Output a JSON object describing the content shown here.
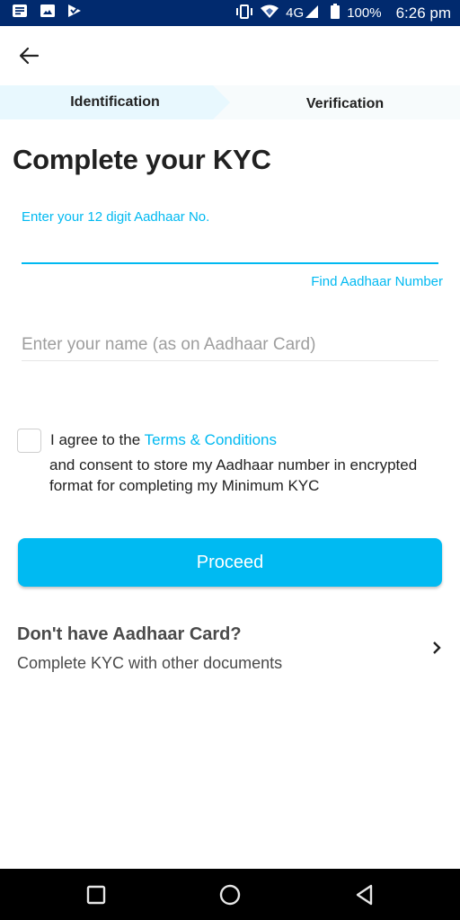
{
  "status_bar": {
    "left_icons": [
      "notes-icon",
      "image-icon",
      "checkmark-app-icon"
    ],
    "right_icons": [
      "vibrate-icon",
      "wifi-icon",
      "signal-icon",
      "battery-icon"
    ],
    "network": "4G",
    "battery": "100%",
    "time": "6:26 pm"
  },
  "toolbar": {
    "back_icon": "arrow-left-icon"
  },
  "stepper": {
    "steps": [
      {
        "label": "Identification",
        "active": true
      },
      {
        "label": "Verification",
        "active": false
      }
    ]
  },
  "page": {
    "title": "Complete your KYC"
  },
  "aadhaar": {
    "label": "Enter your 12 digit Aadhaar No.",
    "value": "",
    "find_link": "Find Aadhaar Number"
  },
  "name": {
    "placeholder": "Enter your name (as on Aadhaar Card)",
    "value": ""
  },
  "consent": {
    "checked": false,
    "prefix": "I agree to the",
    "terms_link": "Terms & Conditions",
    "rest": "and consent to store my Aadhaar number in encrypted format for completing my Minimum KYC"
  },
  "proceed": {
    "label": "Proceed"
  },
  "alternate": {
    "title": "Don't have Aadhaar Card?",
    "subtitle": "Complete KYC with other documents",
    "icon": "chevron-right-icon"
  },
  "nav_bar": {
    "buttons": [
      "recent-apps-icon",
      "home-icon",
      "back-triangle-icon"
    ]
  },
  "colors": {
    "accent": "#00b9f1",
    "status_bar": "#012a6e",
    "step_active_bg": "#e8f8fe",
    "step_inactive_bg": "#f7fbfc"
  }
}
